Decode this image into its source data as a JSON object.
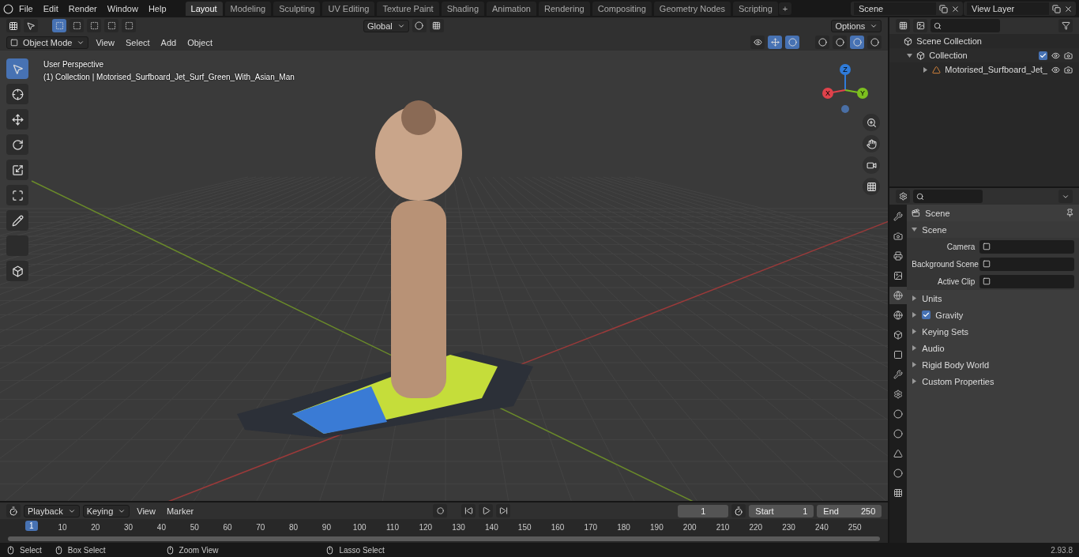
{
  "menus": [
    "File",
    "Edit",
    "Render",
    "Window",
    "Help"
  ],
  "workspaces": [
    {
      "label": "Layout",
      "selected": true
    },
    {
      "label": "Modeling",
      "selected": false
    },
    {
      "label": "Sculpting",
      "selected": false
    },
    {
      "label": "UV Editing",
      "selected": false
    },
    {
      "label": "Texture Paint",
      "selected": false
    },
    {
      "label": "Shading",
      "selected": false
    },
    {
      "label": "Animation",
      "selected": false
    },
    {
      "label": "Rendering",
      "selected": false
    },
    {
      "label": "Compositing",
      "selected": false
    },
    {
      "label": "Geometry Nodes",
      "selected": false
    },
    {
      "label": "Scripting",
      "selected": false
    }
  ],
  "add_workspace": "+",
  "scene_field": "Scene",
  "view_layer_field": "View Layer",
  "viewport_header": {
    "orientation": "Global",
    "options": "Options",
    "mode": "Object Mode",
    "menus": [
      "View",
      "Select",
      "Add",
      "Object"
    ]
  },
  "viewport": {
    "view_name": "User Perspective",
    "object_info": "(1) Collection | Motorised_Surfboard_Jet_Surf_Green_With_Asian_Man",
    "tools": [
      {
        "selected": true
      },
      {
        "selected": false
      },
      {
        "selected": false
      },
      {
        "selected": false
      },
      {
        "selected": false
      },
      {
        "selected": false
      },
      {
        "selected": false
      },
      {
        "selected": false
      },
      {
        "selected": false
      }
    ],
    "gizmo": [
      "Z",
      "X",
      "Y"
    ]
  },
  "outliner": {
    "root": "Scene Collection",
    "children": [
      {
        "name": "Collection",
        "checked": true,
        "expanded": true,
        "children": [
          {
            "name": "Motorised_Surfboard_Jet_",
            "expanded": false
          }
        ]
      }
    ]
  },
  "properties": {
    "tabs": [
      {
        "selected": false
      },
      {
        "selected": false
      },
      {
        "selected": false
      },
      {
        "selected": false
      },
      {
        "selected": true
      },
      {
        "selected": false
      },
      {
        "selected": false
      },
      {
        "selected": false
      },
      {
        "selected": false
      },
      {
        "selected": false
      },
      {
        "selected": false
      },
      {
        "selected": false
      },
      {
        "selected": false
      },
      {
        "selected": false
      },
      {
        "selected": false
      }
    ],
    "context": "Scene",
    "panel": {
      "title": "Scene",
      "expanded": true,
      "fields": [
        {
          "label": "Camera"
        },
        {
          "label": "Background Scene"
        },
        {
          "label": "Active Clip"
        }
      ]
    },
    "subpanels": [
      {
        "title": "Units",
        "kind": "plain"
      },
      {
        "title": "Gravity",
        "kind": "checkbox",
        "checked": true
      },
      {
        "title": "Keying Sets",
        "kind": "plain"
      },
      {
        "title": "Audio",
        "kind": "plain"
      },
      {
        "title": "Rigid Body World",
        "kind": "plain"
      },
      {
        "title": "Custom Properties",
        "kind": "plain"
      }
    ]
  },
  "timeline": {
    "menus": [
      "Playback",
      "Keying",
      "View",
      "Marker"
    ],
    "current_frame": "1",
    "start_label": "Start",
    "start": "1",
    "end_label": "End",
    "end": "250",
    "marker": "1",
    "ticks": [
      "10",
      "20",
      "30",
      "40",
      "50",
      "60",
      "70",
      "80",
      "90",
      "100",
      "110",
      "120",
      "130",
      "140",
      "150",
      "160",
      "170",
      "180",
      "190",
      "200",
      "210",
      "220",
      "230",
      "240",
      "250"
    ]
  },
  "status_bar": {
    "hints": [
      "Select",
      "Box Select",
      "Zoom View",
      "Lasso Select"
    ],
    "version": "2.93.8"
  }
}
